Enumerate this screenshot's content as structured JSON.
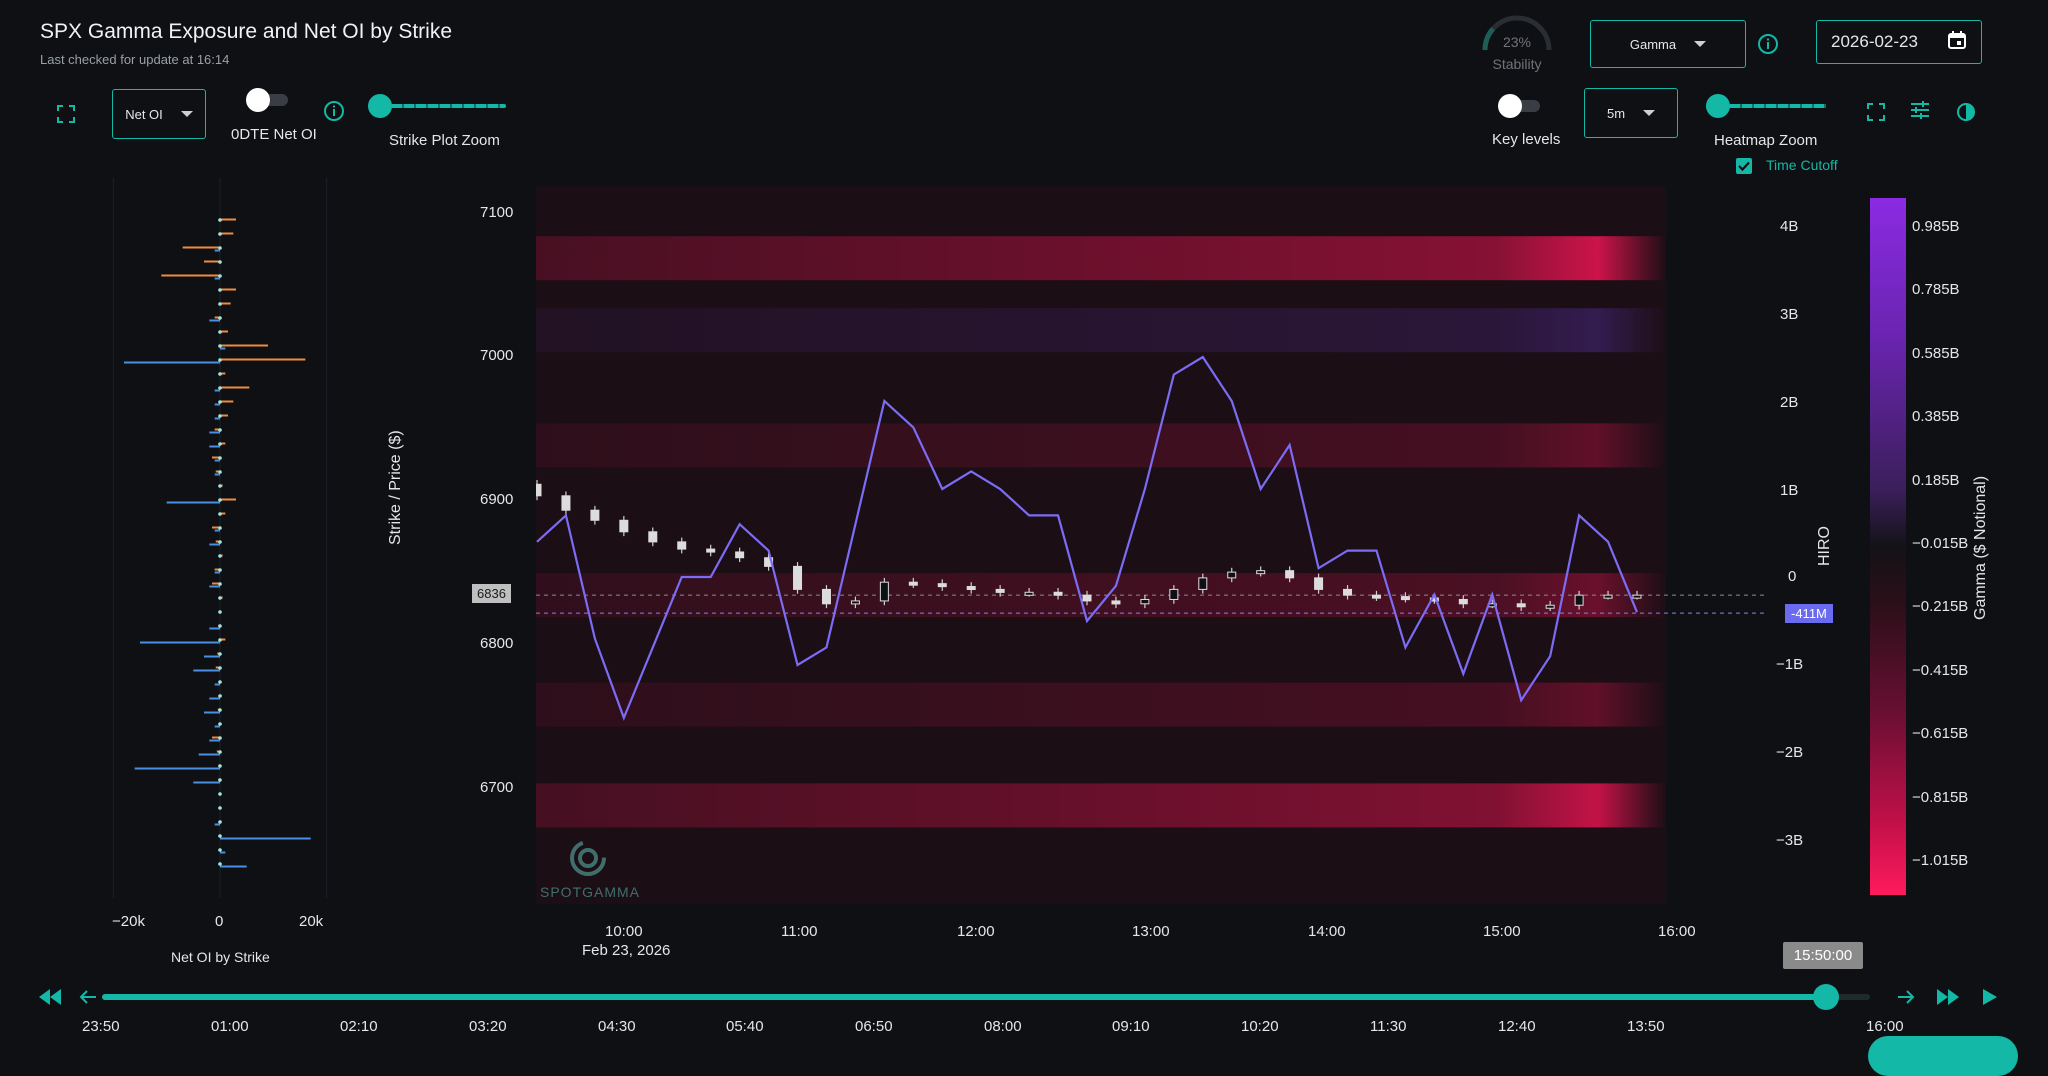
{
  "header": {
    "title": "SPX Gamma Exposure and Net OI by Strike",
    "subtitle": "Last checked for update at 16:14"
  },
  "stability": {
    "percent_label": "23%",
    "label": "Stability",
    "value": 0.23
  },
  "controls": {
    "metric_select": "Gamma",
    "date_value": "2026-02-23",
    "oi_select": "Net OI",
    "odte_label": "0DTE Net OI",
    "strike_zoom_label": "Strike Plot Zoom",
    "key_levels_label": "Key levels",
    "interval_select": "5m",
    "heatmap_zoom_label": "Heatmap Zoom",
    "time_cutoff_label": "Time Cutoff",
    "time_cutoff_checked": true
  },
  "colors": {
    "accent": "#14b8a6",
    "hiro_line": "#7b6cf6",
    "orange": "#f08a3c",
    "blue": "#4a90e2"
  },
  "strike_plot": {
    "xlabel": "Net OI by Strike",
    "x_ticks": [
      "−20k",
      "0",
      "20k"
    ],
    "x_tick_values": [
      -20000,
      0,
      20000
    ]
  },
  "main_chart": {
    "ylabel_left": "Strike / Price ($)",
    "ylabel_right": "HIRO",
    "y_ticks": [
      "7100",
      "7000",
      "6900",
      "6800",
      "6700"
    ],
    "hiro_ticks": [
      "4B",
      "3B",
      "2B",
      "1B",
      "0",
      "−1B",
      "−2B",
      "−3B"
    ],
    "x_ticks": [
      "10:00",
      "11:00",
      "12:00",
      "13:00",
      "14:00",
      "15:00",
      "16:00"
    ],
    "date_label": "Feb 23, 2026",
    "price_badge": "6836",
    "hiro_badge": "-411M",
    "watermark": "SPOTGAMMA"
  },
  "colorbar": {
    "label": "Gamma ($ Notional)",
    "ticks": [
      "0.985B",
      "0.785B",
      "0.585B",
      "0.385B",
      "0.185B",
      "−0.015B",
      "−0.215B",
      "−0.415B",
      "−0.615B",
      "−0.815B",
      "−1.015B"
    ]
  },
  "timeline": {
    "tooltip": "15:50:00",
    "ticks": [
      "23:50",
      "01:00",
      "02:10",
      "03:20",
      "04:30",
      "05:40",
      "06:50",
      "08:00",
      "09:10",
      "10:20",
      "11:30",
      "12:40",
      "13:50",
      "16:00"
    ],
    "progress": 0.975
  },
  "chart_data": [
    {
      "type": "bar",
      "title": "",
      "xlabel": "Net OI by Strike",
      "ylabel": "",
      "xlim": [
        -30000,
        30000
      ],
      "ylim": [
        6620,
        7120
      ],
      "strikes": [
        7100,
        7090,
        7080,
        7070,
        7060,
        7050,
        7040,
        7030,
        7020,
        7010,
        7000,
        6990,
        6980,
        6970,
        6960,
        6950,
        6940,
        6930,
        6920,
        6910,
        6900,
        6890,
        6880,
        6870,
        6860,
        6850,
        6840,
        6830,
        6820,
        6810,
        6800,
        6790,
        6780,
        6770,
        6760,
        6750,
        6740,
        6730,
        6720,
        6710,
        6700,
        6690,
        6680,
        6670,
        6660,
        6650,
        6640
      ],
      "series": [
        {
          "name": "",
          "color": "#f08a3c",
          "values": [
            3000,
            2500,
            -7000,
            -3000,
            -11000,
            3000,
            2000,
            -1000,
            1500,
            9000,
            16000,
            1000,
            5500,
            2500,
            1500,
            -1000,
            1000,
            -1500,
            -800,
            500,
            3000,
            1000,
            -1500,
            -800,
            500,
            -1000,
            -1500,
            500,
            -200,
            -300,
            1000,
            -500,
            -800,
            -200,
            300,
            -400,
            200,
            -1500,
            -600,
            -300,
            -300,
            100,
            -200,
            300,
            -100,
            100,
            -200
          ]
        },
        {
          "name": "",
          "color": "#4a90e2",
          "values": [
            0,
            0,
            -1000,
            0,
            -1000,
            0,
            0,
            -2000,
            0,
            1000,
            -18000,
            0,
            -1000,
            -1000,
            -1000,
            -2000,
            -2000,
            -1000,
            -1000,
            0,
            -10000,
            0,
            -1000,
            -2000,
            0,
            -1000,
            -2000,
            0,
            0,
            -2000,
            -15000,
            -3000,
            -5000,
            -1000,
            -2000,
            -3000,
            -1000,
            -2000,
            -4000,
            -16000,
            -5000,
            0,
            0,
            -1000,
            17000,
            1000,
            5000
          ]
        }
      ]
    },
    {
      "type": "line",
      "title": "",
      "xlabel": "",
      "ylabel": "HIRO",
      "x": [
        "09:30",
        "09:40",
        "09:50",
        "10:00",
        "10:10",
        "10:20",
        "10:30",
        "10:40",
        "10:50",
        "11:00",
        "11:10",
        "11:20",
        "11:30",
        "11:40",
        "11:50",
        "12:00",
        "12:10",
        "12:20",
        "12:30",
        "12:40",
        "12:50",
        "13:00",
        "13:10",
        "13:20",
        "13:30",
        "13:40",
        "13:50",
        "14:00",
        "14:10",
        "14:20",
        "14:30",
        "14:40",
        "14:50",
        "15:00",
        "15:10",
        "15:20",
        "15:30",
        "15:40",
        "15:50"
      ],
      "series": [
        {
          "name": "HIRO",
          "values": [
            0.4,
            0.7,
            -0.7,
            -1.6,
            -0.8,
            0.0,
            0.0,
            0.6,
            0.3,
            -1.0,
            -0.8,
            0.6,
            2.0,
            1.7,
            1.0,
            1.2,
            1.0,
            0.7,
            0.7,
            -0.5,
            -0.1,
            1.0,
            2.3,
            2.5,
            2.0,
            1.0,
            1.5,
            0.1,
            0.3,
            0.3,
            -0.8,
            -0.2,
            -1.1,
            -0.2,
            -1.4,
            -0.9,
            0.7,
            0.4,
            -0.4
          ]
        }
      ],
      "ylim": [
        -3.7,
        4.3
      ],
      "yunit": "B"
    },
    {
      "type": "candlestick",
      "title": "",
      "ylabel": "Strike / Price ($)",
      "x": [
        "09:30",
        "09:40",
        "09:50",
        "10:00",
        "10:10",
        "10:20",
        "10:30",
        "10:40",
        "10:50",
        "11:00",
        "11:10",
        "11:20",
        "11:30",
        "11:40",
        "11:50",
        "12:00",
        "12:10",
        "12:20",
        "12:30",
        "12:40",
        "12:50",
        "13:00",
        "13:10",
        "13:20",
        "13:30",
        "13:40",
        "13:50",
        "14:00",
        "14:10",
        "14:20",
        "14:30",
        "14:40",
        "14:50",
        "15:00",
        "15:10",
        "15:20",
        "15:30",
        "15:40",
        "15:50"
      ],
      "close": [
        6905,
        6895,
        6888,
        6880,
        6873,
        6868,
        6866,
        6862,
        6856,
        6840,
        6830,
        6832,
        6845,
        6844,
        6842,
        6840,
        6838,
        6838,
        6836,
        6832,
        6830,
        6833,
        6840,
        6848,
        6852,
        6853,
        6848,
        6840,
        6836,
        6835,
        6834,
        6833,
        6830,
        6830,
        6828,
        6829,
        6836,
        6836,
        6836
      ],
      "ylim": [
        6620,
        7120
      ]
    },
    {
      "type": "heatmap",
      "title": "",
      "zlabel": "Gamma ($ Notional)",
      "zlim": [
        -1.1,
        1.05
      ],
      "zunit": "B",
      "rows": [
        {
          "strike": 7070,
          "gamma": -0.9
        },
        {
          "strike": 7020,
          "gamma": 0.5
        },
        {
          "strike": 6940,
          "gamma": -0.35
        },
        {
          "strike": 6836,
          "gamma": -0.4
        },
        {
          "strike": 6760,
          "gamma": -0.35
        },
        {
          "strike": 6690,
          "gamma": -0.85
        }
      ]
    }
  ]
}
